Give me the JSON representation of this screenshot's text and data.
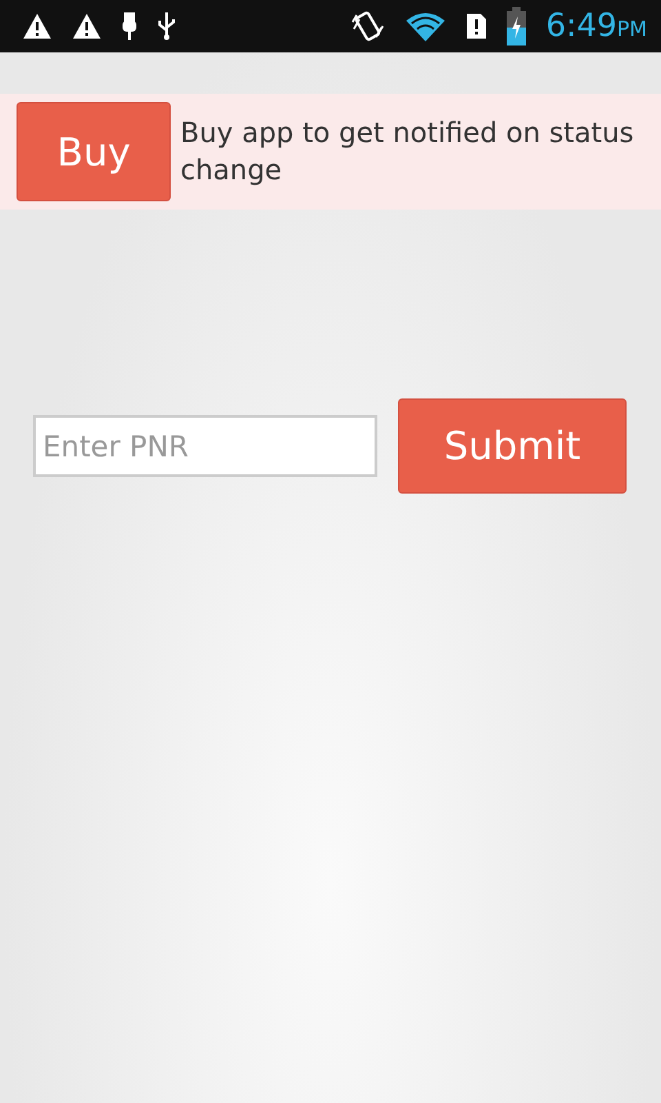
{
  "status_bar": {
    "time": "6:49",
    "period": "PM"
  },
  "banner": {
    "button": "Buy",
    "message": "Buy app to get notified on status change"
  },
  "form": {
    "placeholder": "Enter PNR",
    "submit": "Submit"
  }
}
